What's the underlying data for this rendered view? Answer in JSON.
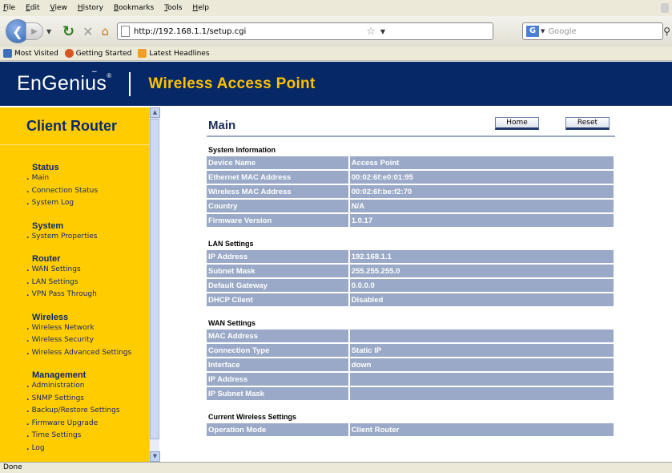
{
  "browser": {
    "menu": [
      "File",
      "Edit",
      "View",
      "History",
      "Bookmarks",
      "Tools",
      "Help"
    ],
    "url": "http://192.168.1.1/setup.cgi",
    "search_placeholder": "Google",
    "bookmarks": [
      {
        "label": "Most Visited",
        "icon": "globe-icon",
        "color": "#3b6fc0"
      },
      {
        "label": "Getting Started",
        "icon": "firefox-icon",
        "color": "#d4581f"
      },
      {
        "label": "Latest Headlines",
        "icon": "rss-icon",
        "color": "#f0a020"
      }
    ],
    "status": "Done"
  },
  "banner": {
    "logo": "EnGenius",
    "logo_mark": "®",
    "title": "Wireless Access Point",
    "bg_color": "#062866",
    "title_color": "#ffc000"
  },
  "sidebar": {
    "header": "Client Router",
    "bg_color": "#ffcc00",
    "sections": [
      {
        "title": "Status",
        "links": [
          "Main",
          "Connection Status",
          "System Log"
        ]
      },
      {
        "title": "System",
        "links": [
          "System Properties"
        ]
      },
      {
        "title": "Router",
        "links": [
          "WAN Settings",
          "LAN Settings",
          "VPN Pass Through"
        ]
      },
      {
        "title": "Wireless",
        "links": [
          "Wireless Network",
          "Wireless Security",
          "Wireless Advanced Settings"
        ]
      },
      {
        "title": "Management",
        "links": [
          "Administration",
          "SNMP Settings",
          "Backup/Restore Settings",
          "Firmware Upgrade",
          "Time Settings",
          "Log"
        ]
      }
    ]
  },
  "main": {
    "title": "Main",
    "buttons": {
      "home": "Home",
      "reset": "Reset"
    },
    "sections": [
      {
        "title": "System Information",
        "rows": [
          [
            "Device Name",
            "Access Point"
          ],
          [
            "Ethernet MAC Address",
            "00:02:6f:e0:01:95"
          ],
          [
            "Wireless MAC Address",
            "00:02:6f:be:f2:70"
          ],
          [
            "Country",
            "N/A"
          ],
          [
            "Firmware Version",
            "1.0.17"
          ]
        ]
      },
      {
        "title": "LAN Settings",
        "rows": [
          [
            "IP Address",
            "192.168.1.1"
          ],
          [
            "Subnet Mask",
            "255.255.255.0"
          ],
          [
            "Default Gateway",
            "0.0.0.0"
          ],
          [
            "DHCP Client",
            "Disabled"
          ]
        ]
      },
      {
        "title": "WAN Settings",
        "rows": [
          [
            "MAC Address",
            ""
          ],
          [
            "Connection Type",
            "Static IP"
          ],
          [
            "Interface",
            "down"
          ],
          [
            "IP Address",
            ""
          ],
          [
            "IP Subnet Mask",
            ""
          ]
        ]
      },
      {
        "title": "Current Wireless Settings",
        "rows": [
          [
            "Operation Mode",
            "Client Router"
          ]
        ]
      }
    ]
  }
}
